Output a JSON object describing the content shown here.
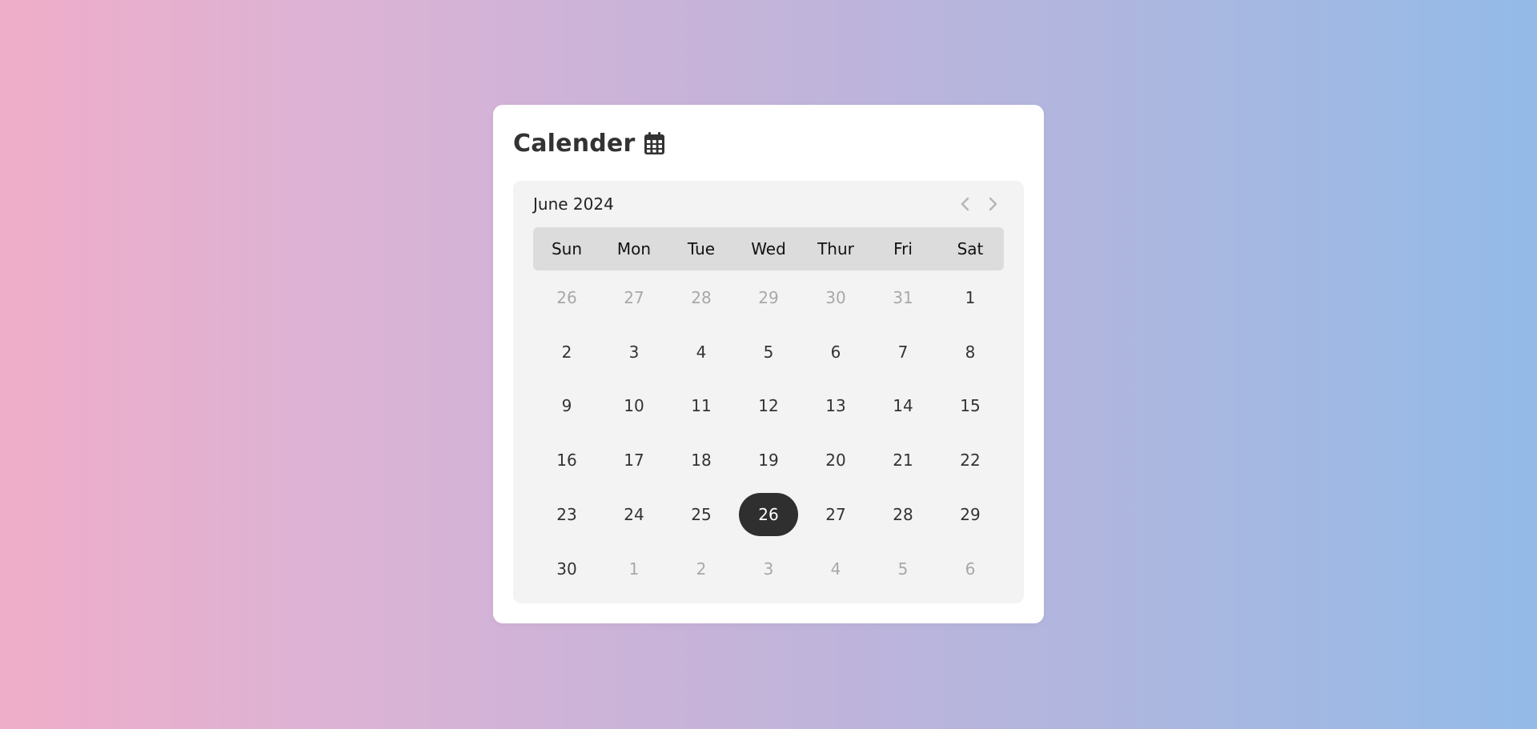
{
  "app": {
    "title": "Calender",
    "title_icon": "calendar-icon"
  },
  "calendar": {
    "month_label": "June 2024",
    "nav": {
      "prev_icon": "chevron-left-icon",
      "next_icon": "chevron-right-icon"
    },
    "weekdays": [
      "Sun",
      "Mon",
      "Tue",
      "Wed",
      "Thur",
      "Fri",
      "Sat"
    ],
    "selected_day": "26",
    "days": [
      {
        "label": "26",
        "in_month": false
      },
      {
        "label": "27",
        "in_month": false
      },
      {
        "label": "28",
        "in_month": false
      },
      {
        "label": "29",
        "in_month": false
      },
      {
        "label": "30",
        "in_month": false
      },
      {
        "label": "31",
        "in_month": false
      },
      {
        "label": "1",
        "in_month": true
      },
      {
        "label": "2",
        "in_month": true
      },
      {
        "label": "3",
        "in_month": true
      },
      {
        "label": "4",
        "in_month": true
      },
      {
        "label": "5",
        "in_month": true
      },
      {
        "label": "6",
        "in_month": true
      },
      {
        "label": "7",
        "in_month": true
      },
      {
        "label": "8",
        "in_month": true
      },
      {
        "label": "9",
        "in_month": true
      },
      {
        "label": "10",
        "in_month": true
      },
      {
        "label": "11",
        "in_month": true
      },
      {
        "label": "12",
        "in_month": true
      },
      {
        "label": "13",
        "in_month": true
      },
      {
        "label": "14",
        "in_month": true
      },
      {
        "label": "15",
        "in_month": true
      },
      {
        "label": "16",
        "in_month": true
      },
      {
        "label": "17",
        "in_month": true
      },
      {
        "label": "18",
        "in_month": true
      },
      {
        "label": "19",
        "in_month": true
      },
      {
        "label": "20",
        "in_month": true
      },
      {
        "label": "21",
        "in_month": true
      },
      {
        "label": "22",
        "in_month": true
      },
      {
        "label": "23",
        "in_month": true
      },
      {
        "label": "24",
        "in_month": true
      },
      {
        "label": "25",
        "in_month": true
      },
      {
        "label": "26",
        "in_month": true,
        "selected": true
      },
      {
        "label": "27",
        "in_month": true
      },
      {
        "label": "28",
        "in_month": true
      },
      {
        "label": "29",
        "in_month": true
      },
      {
        "label": "30",
        "in_month": true
      },
      {
        "label": "1",
        "in_month": false
      },
      {
        "label": "2",
        "in_month": false
      },
      {
        "label": "3",
        "in_month": false
      },
      {
        "label": "4",
        "in_month": false
      },
      {
        "label": "5",
        "in_month": false
      },
      {
        "label": "6",
        "in_month": false
      }
    ]
  },
  "colors": {
    "gradient_start": "#efadc9",
    "gradient_end": "#93bbe8",
    "card": "#ffffff",
    "panel": "#f3f3f3",
    "weekday_bar": "#dcdcdc",
    "selected_bg": "#2f2f2f",
    "muted_text": "#a8a8a8"
  }
}
